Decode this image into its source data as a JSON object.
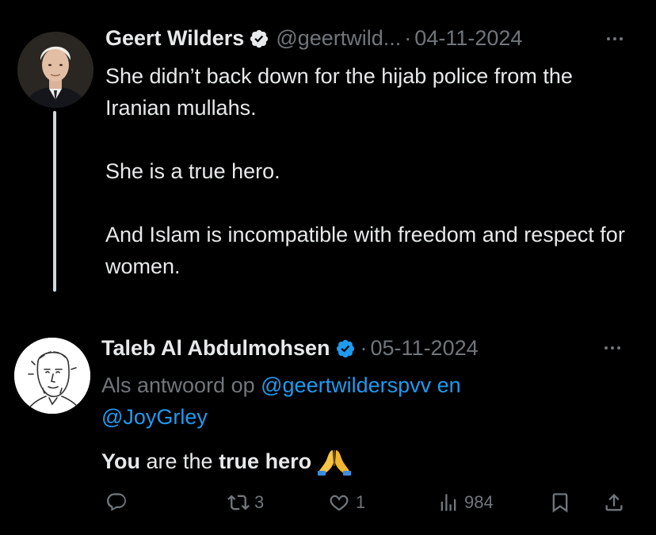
{
  "tweet": {
    "author_name": "Geert Wilders",
    "handle": "@geertwild...",
    "separator": "·",
    "date": "04-11-2024",
    "text": "She didn’t back down for the hijab police from the Iranian mullahs.\n\nShe is a true hero.\n\nAnd Islam is incompatible with freedom and respect for women."
  },
  "reply": {
    "author_name": "Taleb Al Abdulmohsen",
    "separator": "·",
    "date": "05-11-2024",
    "reply_prefix": "Als antwoord op ",
    "mention1": "@geertwilderspvv",
    "conjunction": " en",
    "mention2": "@JoyGrley",
    "text_part1": "You",
    "text_part2": " are the ",
    "text_part3": "true hero",
    "emoji": "folded-hands-emoji",
    "stats": {
      "retweets": "3",
      "likes": "1",
      "views": "984"
    }
  },
  "colors": {
    "background": "#000000",
    "text": "#e7e9ea",
    "muted": "#71767b",
    "link": "#1d9bf0",
    "verified": "#1d9bf0"
  }
}
